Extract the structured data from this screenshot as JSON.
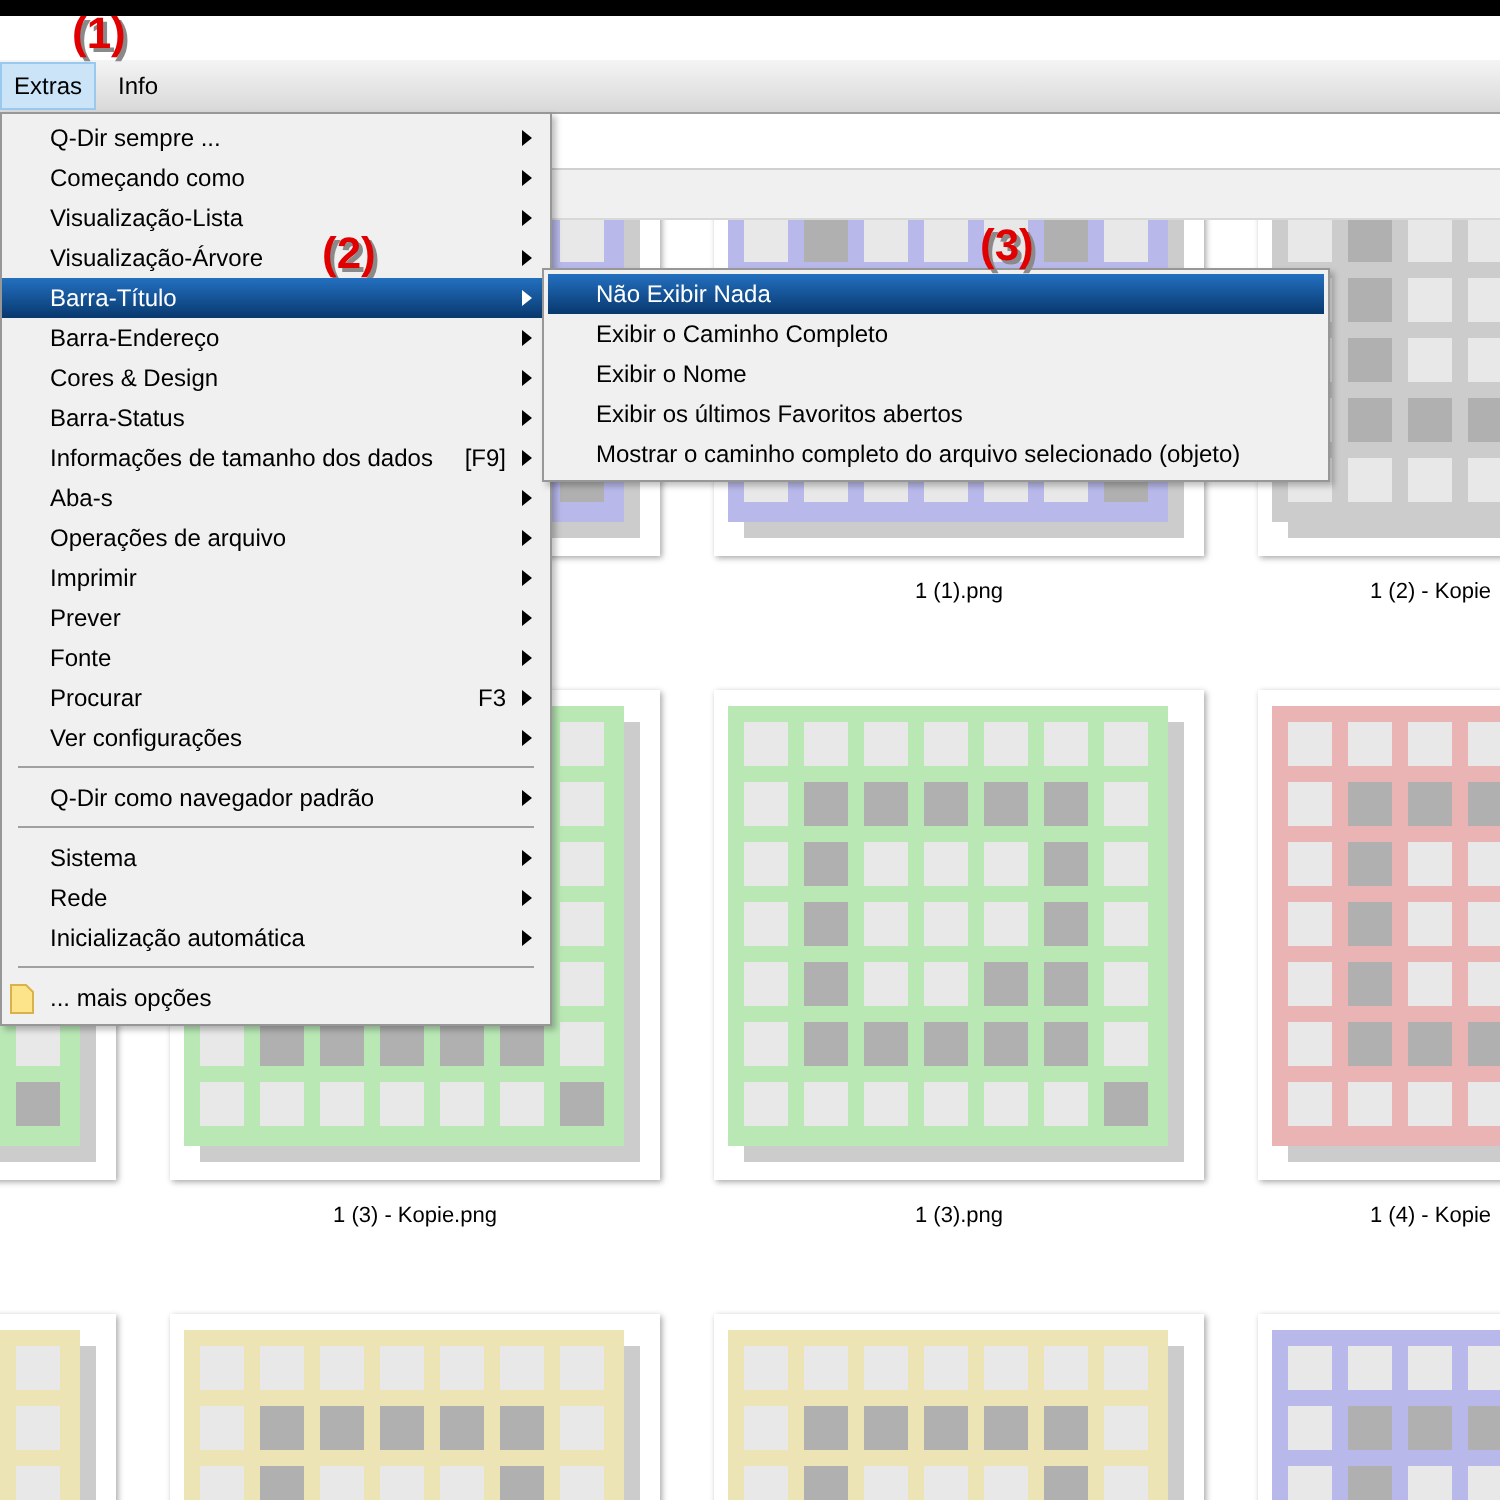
{
  "annotations": [
    {
      "text": "(1)"
    },
    {
      "text": "(3)"
    }
  ],
  "menu_bar": {
    "items": [
      {
        "label": "Extras",
        "selected": true
      },
      {
        "label": "Info",
        "selected": false
      }
    ]
  },
  "thumbnails": {
    "rows": [
      {
        "cards": [
          {
            "color": "#b8b8ea"
          },
          {
            "color": "#b8b8ea",
            "label": "1 (1).png"
          },
          {
            "color": "#cccccc",
            "label": "1 (2) - Kopie"
          }
        ]
      },
      {
        "cards": [
          {
            "color": "#b9e8b5"
          },
          {
            "color": "#b9e8b5",
            "label": "1 (3) - Kopie.png"
          },
          {
            "color": "#b9e8b5",
            "label": "1 (3).png"
          },
          {
            "color": "#ebb4b4",
            "label": "1 (4) - Kopie"
          }
        ]
      },
      {
        "cards": [
          {
            "color": "#ece4b4"
          },
          {
            "color": "#ece4b4"
          },
          {
            "color": "#ece4b4"
          },
          {
            "color": "#b8b8ea"
          }
        ]
      }
    ]
  },
  "extras_menu": {
    "items": [
      {
        "kind": "submenu",
        "label": "Q-Dir sempre ...",
        "selected": false
      },
      {
        "kind": "submenu",
        "label": "Começando como",
        "selected": false
      },
      {
        "kind": "submenu",
        "label": "Visualização-Lista",
        "selected": false
      },
      {
        "kind": "submenu",
        "label": "Visualização-Árvore",
        "annotation": "(2)",
        "selected": false
      },
      {
        "kind": "submenu",
        "label": "Barra-Título",
        "selected": true
      },
      {
        "kind": "submenu",
        "label": "Barra-Endereço",
        "selected": false
      },
      {
        "kind": "submenu",
        "label": "Cores & Design",
        "selected": false
      },
      {
        "kind": "submenu",
        "label": "Barra-Status",
        "selected": false
      },
      {
        "kind": "submenu",
        "label": "Informações de tamanho dos dados",
        "shortcut": "[F9]",
        "selected": false
      },
      {
        "kind": "submenu",
        "label": "Aba-s",
        "selected": false
      },
      {
        "kind": "submenu",
        "label": "Operações de arquivo",
        "selected": false
      },
      {
        "kind": "submenu",
        "label": "Imprimir",
        "selected": false
      },
      {
        "kind": "submenu",
        "label": "Prever",
        "selected": false
      },
      {
        "kind": "submenu",
        "label": "Fonte",
        "selected": false
      },
      {
        "kind": "submenu",
        "label": "Procurar",
        "shortcut": "F3",
        "selected": false
      },
      {
        "kind": "submenu",
        "label": "Ver configurações",
        "selected": false
      },
      {
        "kind": "separator"
      },
      {
        "kind": "submenu",
        "label": "Q-Dir como navegador padrão",
        "selected": false
      },
      {
        "kind": "separator"
      },
      {
        "kind": "submenu",
        "label": "Sistema",
        "selected": false
      },
      {
        "kind": "submenu",
        "label": "Rede",
        "selected": false
      },
      {
        "kind": "submenu",
        "label": "Inicialização automática",
        "selected": false
      },
      {
        "kind": "separator"
      },
      {
        "kind": "folder",
        "label": "... mais opções",
        "selected": false
      }
    ]
  },
  "title_bar_submenu": {
    "items": [
      {
        "label": "Não Exibir Nada",
        "selected": true
      },
      {
        "label": "Exibir o Caminho Completo",
        "selected": false
      },
      {
        "label": "Exibir o Nome",
        "selected": false
      },
      {
        "label": "Exibir os últimos Favoritos abertos",
        "selected": false
      },
      {
        "label": "Mostrar o caminho completo do arquivo selecionado (objeto)",
        "selected": false
      }
    ]
  }
}
